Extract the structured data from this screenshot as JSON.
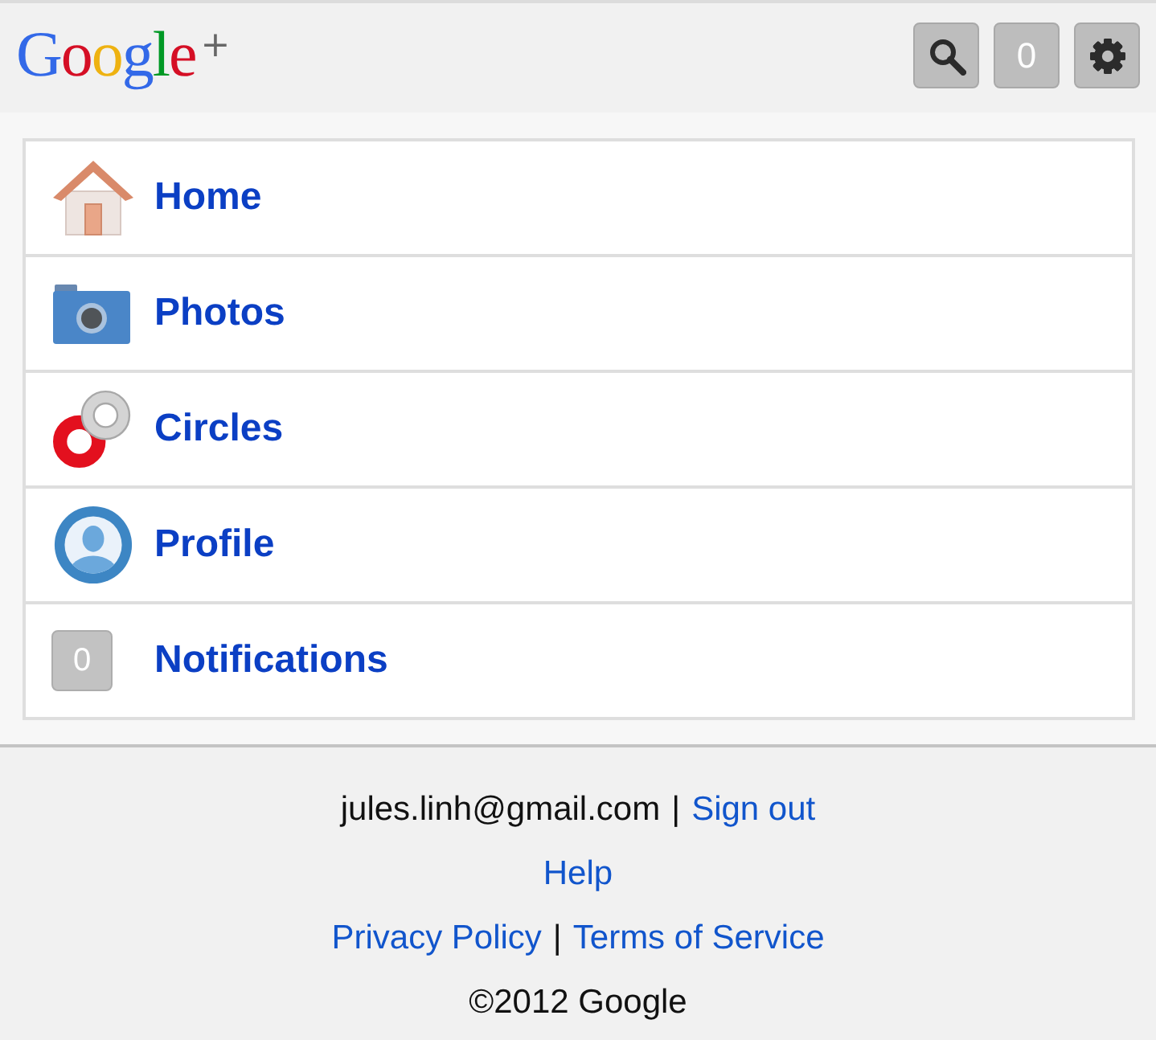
{
  "header": {
    "logo": {
      "text": "Google",
      "suffix": "+"
    },
    "buttons": [
      {
        "kind": "search"
      },
      {
        "kind": "count",
        "label": "0"
      },
      {
        "kind": "settings"
      }
    ]
  },
  "menu": {
    "items": [
      {
        "kind": "home",
        "label": "Home"
      },
      {
        "kind": "photos",
        "label": "Photos"
      },
      {
        "kind": "circles",
        "label": "Circles"
      },
      {
        "kind": "profile",
        "label": "Profile"
      },
      {
        "kind": "count",
        "badge": "0",
        "label": "Notifications"
      }
    ]
  },
  "footer": {
    "lines": [
      [
        {
          "kind": "text",
          "text": "jules.linh@gmail.com"
        },
        {
          "kind": "sep",
          "text": "|"
        },
        {
          "kind": "link",
          "text": "Sign out"
        }
      ],
      [
        {
          "kind": "link",
          "text": "Help"
        }
      ],
      [
        {
          "kind": "link",
          "text": "Privacy Policy"
        },
        {
          "kind": "sep",
          "text": "|"
        },
        {
          "kind": "link",
          "text": "Terms of Service"
        }
      ],
      [
        {
          "kind": "text",
          "text": "©2012 Google"
        }
      ]
    ]
  }
}
